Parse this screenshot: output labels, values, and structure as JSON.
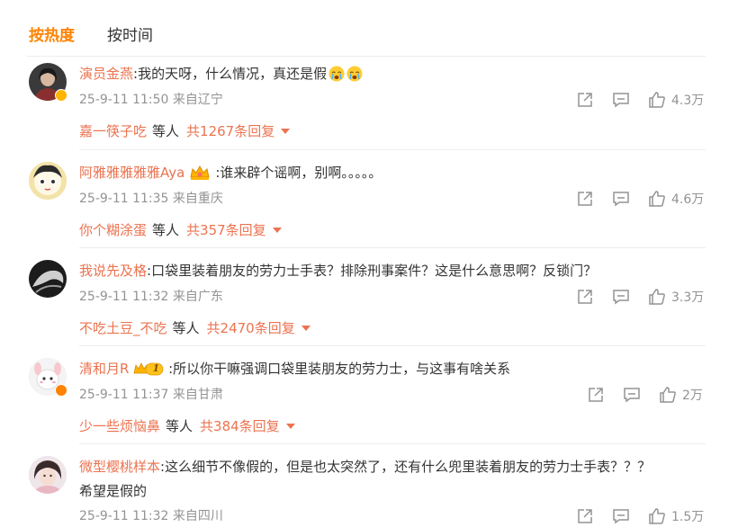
{
  "tabs": [
    {
      "label": "按热度",
      "active": true
    },
    {
      "label": "按时间",
      "active": false
    }
  ],
  "colors": {
    "accent": "#ff8200",
    "username": "#eb7350",
    "meta": "#939393",
    "text": "#333333"
  },
  "comments": [
    {
      "user": "演员金燕",
      "text": ":我的天呀，什么情况，真还是假",
      "emojis": [
        "crying-face-icon",
        "crying-face-icon"
      ],
      "verified_badge": true,
      "time": "25-9-11 11:50",
      "location": "来自辽宁",
      "likes": "4.3万",
      "reply_user": "嘉一筷子吃",
      "reply_mid": "等人",
      "reply_total": "共1267条回复"
    },
    {
      "user": "阿雅雅雅雅雅Aya",
      "text": ":谁来辟个谣啊，别啊。。。。。",
      "badge_icon": "crown-icon",
      "time": "25-9-11 11:35",
      "location": "来自重庆",
      "likes": "4.6万",
      "reply_user": "你个糊涂蛋",
      "reply_mid": "等人",
      "reply_total": "共357条回复"
    },
    {
      "user": "我说先及格",
      "text": ":口袋里装着朋友的劳力士手表？排除刑事案件？这是什么意思啊？反锁门？",
      "time": "25-9-11 11:32",
      "location": "来自广东",
      "likes": "3.3万",
      "reply_user": "不吃土豆_不吃",
      "reply_mid": "等人",
      "reply_total": "共2470条回复"
    },
    {
      "user": "清和月R",
      "vip_level": "1",
      "text": ":所以你干嘛强调口袋里装朋友的劳力士，与这事有啥关系",
      "verified_badge": true,
      "time": "25-9-11 11:37",
      "location": "来自甘肃",
      "likes": "2万",
      "reply_user": "少一些烦恼鼻",
      "reply_mid": "等人",
      "reply_total": "共384条回复"
    },
    {
      "user": "微型樱桃样本",
      "text": ":这么细节不像假的，但是也太突然了，还有什么兜里装着朋友的劳力士手表？？？",
      "text2": "希望是假的",
      "time": "25-9-11 11:32",
      "location": "来自四川",
      "likes": "1.5万"
    }
  ]
}
